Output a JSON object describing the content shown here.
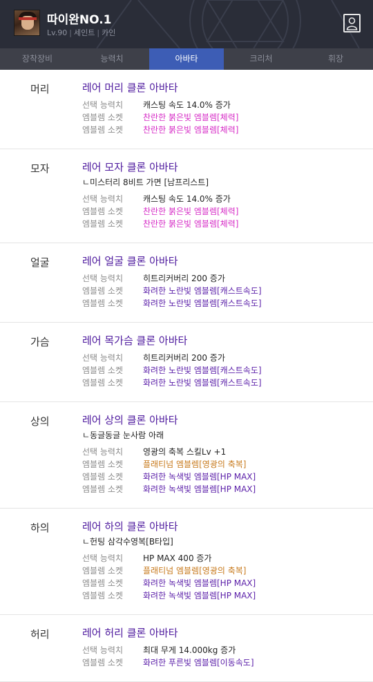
{
  "character": {
    "name": "따이완NO.1",
    "level": "Lv.90",
    "server": "세인트",
    "job": "카인"
  },
  "tabs": [
    {
      "label": "장착장비",
      "active": false
    },
    {
      "label": "능력치",
      "active": false
    },
    {
      "label": "아바타",
      "active": true
    },
    {
      "label": "크리처",
      "active": false
    },
    {
      "label": "휘장",
      "active": false
    }
  ],
  "colors": {
    "header_bg": "#2a2d38",
    "tab_bar_bg": "#3e4049",
    "tab_active_bg": "#3d5db5",
    "title_purple": "#4e1a9e",
    "emblem_pink": "#d62bc6",
    "emblem_purple": "#5a1ea8",
    "emblem_orange": "#c7781a"
  },
  "labels": {
    "option": "선택 능력치",
    "emblem": "엠블렘 소켓"
  },
  "avatars": [
    {
      "slot": "머리",
      "title": "레어 머리 클론 아바타",
      "subtitle": "",
      "option": "캐스팅 속도 14.0% 증가",
      "emblems": [
        {
          "text": "찬란한 붉은빛 엠블렘[체력]",
          "color": "pink"
        },
        {
          "text": "찬란한 붉은빛 엠블렘[체력]",
          "color": "pink"
        }
      ]
    },
    {
      "slot": "모자",
      "title": "레어 모자 클론 아바타",
      "subtitle": "ㄴ미스터리 8비트 가면 [남프리스트]",
      "option": "캐스팅 속도 14.0% 증가",
      "emblems": [
        {
          "text": "찬란한 붉은빛 엠블렘[체력]",
          "color": "pink"
        },
        {
          "text": "찬란한 붉은빛 엠블렘[체력]",
          "color": "pink"
        }
      ]
    },
    {
      "slot": "얼굴",
      "title": "레어 얼굴 클론 아바타",
      "subtitle": "",
      "option": "히트리커버리 200 증가",
      "emblems": [
        {
          "text": "화려한 노란빛 엠블렘[캐스트속도]",
          "color": "purple"
        },
        {
          "text": "화려한 노란빛 엠블렘[캐스트속도]",
          "color": "purple"
        }
      ]
    },
    {
      "slot": "가슴",
      "title": "레어 목가슴 클론 아바타",
      "subtitle": "",
      "option": "히트리커버리 200 증가",
      "emblems": [
        {
          "text": "화려한 노란빛 엠블렘[캐스트속도]",
          "color": "purple"
        },
        {
          "text": "화려한 노란빛 엠블렘[캐스트속도]",
          "color": "purple"
        }
      ]
    },
    {
      "slot": "상의",
      "title": "레어 상의 클론 아바타",
      "subtitle": "ㄴ동글동글 눈사람 아래",
      "option": "영광의 축복 스킬Lv +1",
      "emblems": [
        {
          "text": "플래티넘 엠블렘[영광의 축복]",
          "color": "orange"
        },
        {
          "text": "화려한 녹색빛 엠블렘[HP MAX]",
          "color": "purple"
        },
        {
          "text": "화려한 녹색빛 엠블렘[HP MAX]",
          "color": "purple"
        }
      ]
    },
    {
      "slot": "하의",
      "title": "레어 하의 클론 아바타",
      "subtitle": "ㄴ헌팅 삼각수영복[B타입]",
      "option": "HP MAX 400 증가",
      "emblems": [
        {
          "text": "플래티넘 엠블렘[영광의 축복]",
          "color": "orange"
        },
        {
          "text": "화려한 녹색빛 엠블렘[HP MAX]",
          "color": "purple"
        },
        {
          "text": "화려한 녹색빛 엠블렘[HP MAX]",
          "color": "purple"
        }
      ]
    },
    {
      "slot": "허리",
      "title": "레어 허리 클론 아바타",
      "subtitle": "",
      "option": "최대 무게 14.000kg 증가",
      "emblems": [
        {
          "text": "화려한 푸른빛 엠블렘[이동속도]",
          "color": "purple"
        }
      ]
    }
  ]
}
